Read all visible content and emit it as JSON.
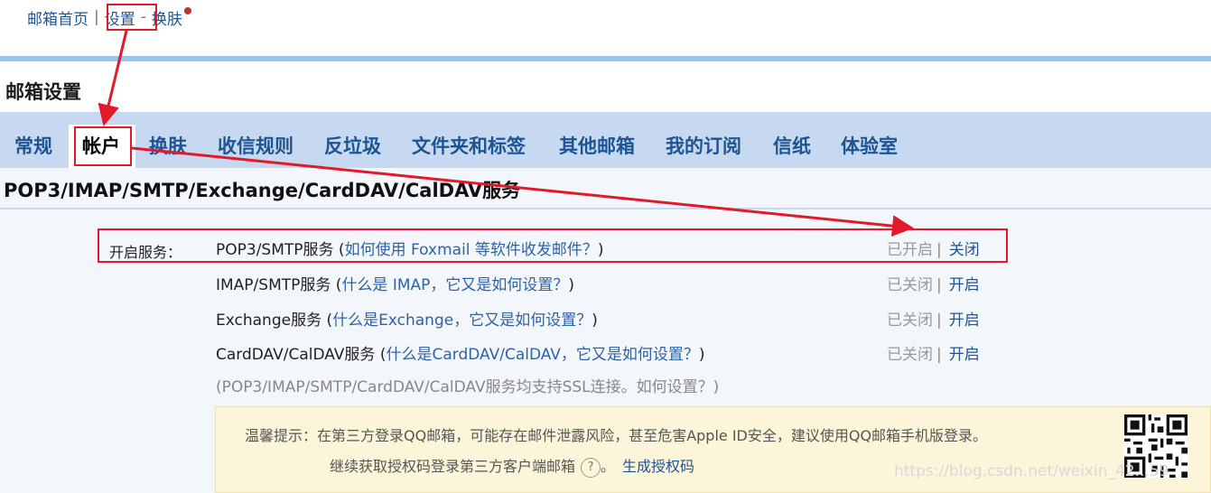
{
  "topnav": {
    "home": "邮箱首页",
    "separator": "|",
    "settings": "设置",
    "dash": "-",
    "skin": "换肤"
  },
  "page_title": "邮箱设置",
  "tabs": [
    {
      "label": "常规"
    },
    {
      "label": "帐户",
      "active": true
    },
    {
      "label": "换肤"
    },
    {
      "label": "收信规则"
    },
    {
      "label": "反垃圾"
    },
    {
      "label": "文件夹和标签"
    },
    {
      "label": "其他邮箱"
    },
    {
      "label": "我的订阅"
    },
    {
      "label": "信纸"
    },
    {
      "label": "体验室"
    }
  ],
  "section_title": "POP3/IMAP/SMTP/Exchange/CardDAV/CalDAV服务",
  "services_label": "开启服务：",
  "services": [
    {
      "name": "POP3/SMTP服务",
      "paren_open": " (",
      "link": "如何使用 Foxmail 等软件收发邮件？",
      "paren_close": ")",
      "status": "已开启",
      "bar": "|",
      "action": "关闭"
    },
    {
      "name": "IMAP/SMTP服务",
      "paren_open": " (",
      "link": "什么是 IMAP，它又是如何设置？",
      "paren_close": ")",
      "status": "已关闭",
      "bar": "|",
      "action": "开启"
    },
    {
      "name": "Exchange服务",
      "paren_open": " (",
      "link": "什么是Exchange，它又是如何设置？",
      "paren_close": ")",
      "status": "已关闭",
      "bar": "|",
      "action": "开启"
    },
    {
      "name": "CardDAV/CalDAV服务",
      "paren_open": " (",
      "link": "什么是CardDAV/CalDAV，它又是如何设置？",
      "paren_close": ")",
      "status": "已关闭",
      "bar": "|",
      "action": "开启"
    }
  ],
  "ssl_note": {
    "prefix": "(POP3/IMAP/SMTP/CardDAV/CalDAV服务均支持SSL连接。",
    "link": "如何设置？",
    "suffix": ")"
  },
  "tip": {
    "line1": "温馨提示：在第三方登录QQ邮箱，可能存在邮件泄露风险，甚至危害Apple ID安全，建议使用QQ邮箱手机版登录。",
    "line2": "继续获取授权码登录第三方客户端邮箱",
    "help_symbol": "?",
    "period": "。",
    "link": "生成授权码"
  },
  "watermark": "https://blog.csdn.net/weixin_42...59",
  "colors": {
    "annotation_red": "#e1192a",
    "link_blue": "#1e5494",
    "tab_bar": "#c6d9f0",
    "tip_bg": "#fcf5d9"
  },
  "icons": [
    "help-circle-icon",
    "qr-code-icon",
    "notification-dot-icon"
  ]
}
